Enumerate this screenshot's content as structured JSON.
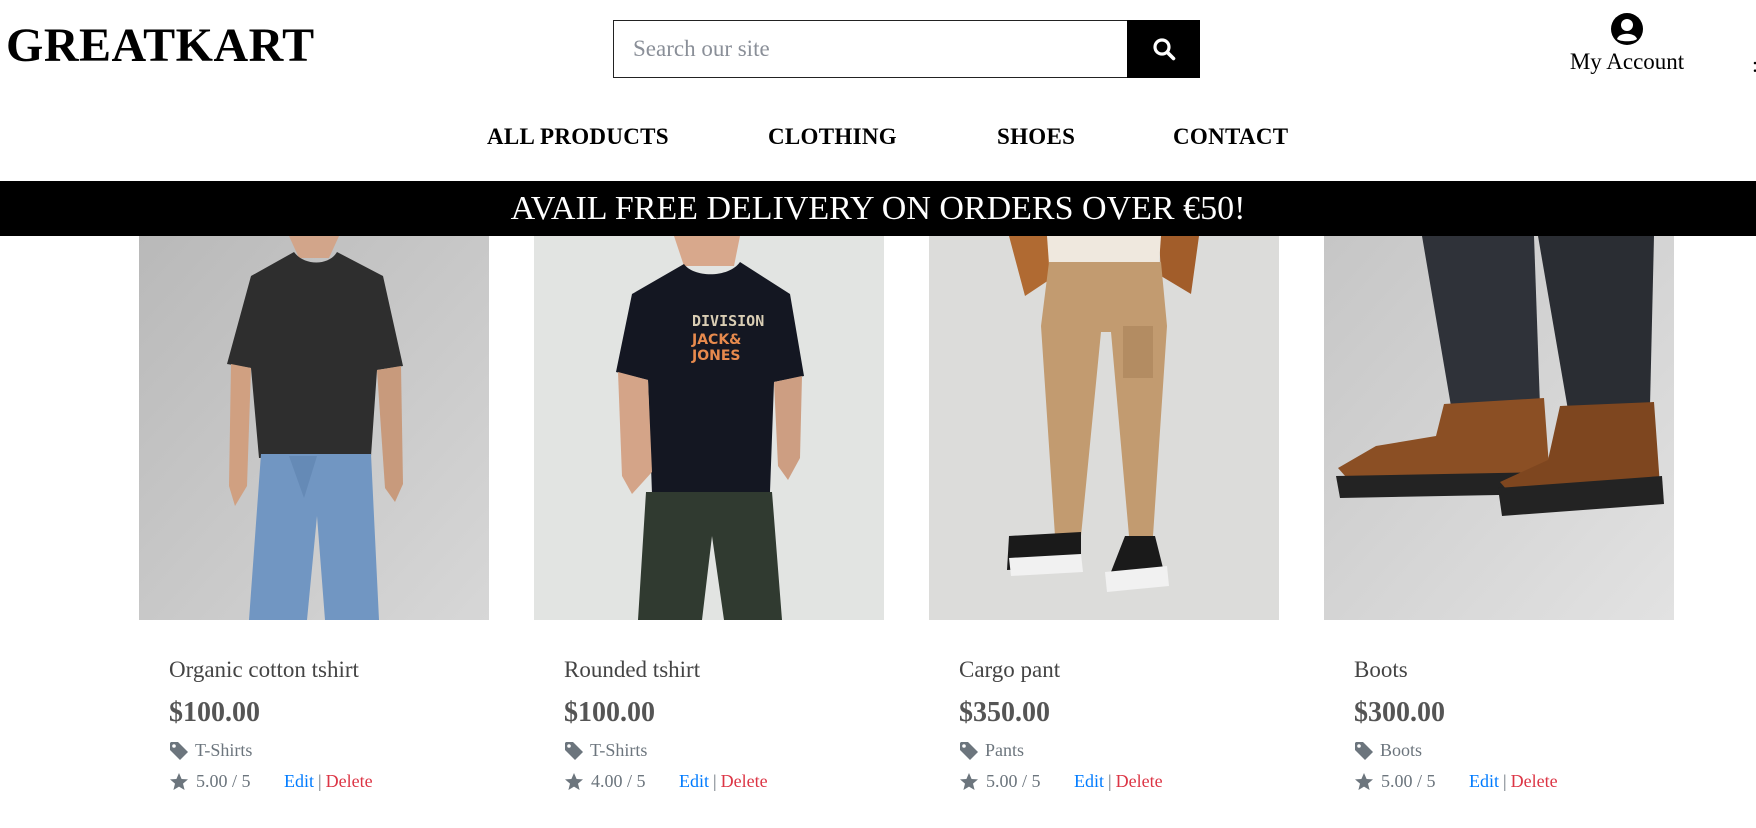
{
  "header": {
    "logo": "GREATKART",
    "search": {
      "placeholder": "Search our site",
      "value": ""
    },
    "account": {
      "label": "My Account"
    }
  },
  "nav": {
    "items": [
      {
        "label": "ALL PRODUCTS"
      },
      {
        "label": "CLOTHING"
      },
      {
        "label": "SHOES"
      },
      {
        "label": "CONTACT"
      }
    ]
  },
  "banner": {
    "text": "AVAIL FREE DELIVERY ON ORDERS OVER €50!"
  },
  "products": [
    {
      "name": "Organic cotton tshirt",
      "price": "$100.00",
      "category": "T-Shirts",
      "rating": "5.00 / 5",
      "edit": "Edit",
      "delete": "Delete"
    },
    {
      "name": "Rounded tshirt",
      "price": "$100.00",
      "category": "T-Shirts",
      "rating": "4.00 / 5",
      "edit": "Edit",
      "delete": "Delete"
    },
    {
      "name": "Cargo pant",
      "price": "$350.00",
      "category": "Pants",
      "rating": "5.00 / 5",
      "edit": "Edit",
      "delete": "Delete"
    },
    {
      "name": "Boots",
      "price": "$300.00",
      "category": "Boots",
      "rating": "5.00 / 5",
      "edit": "Edit",
      "delete": "Delete"
    }
  ],
  "icons": {
    "search": "search-icon",
    "account": "user-circle-icon",
    "tag": "tag-icon",
    "star": "star-icon"
  },
  "colors": {
    "banner_bg": "#000000",
    "edit_link": "#007bff",
    "delete_link": "#dc3545",
    "muted_text": "#6c757d"
  }
}
